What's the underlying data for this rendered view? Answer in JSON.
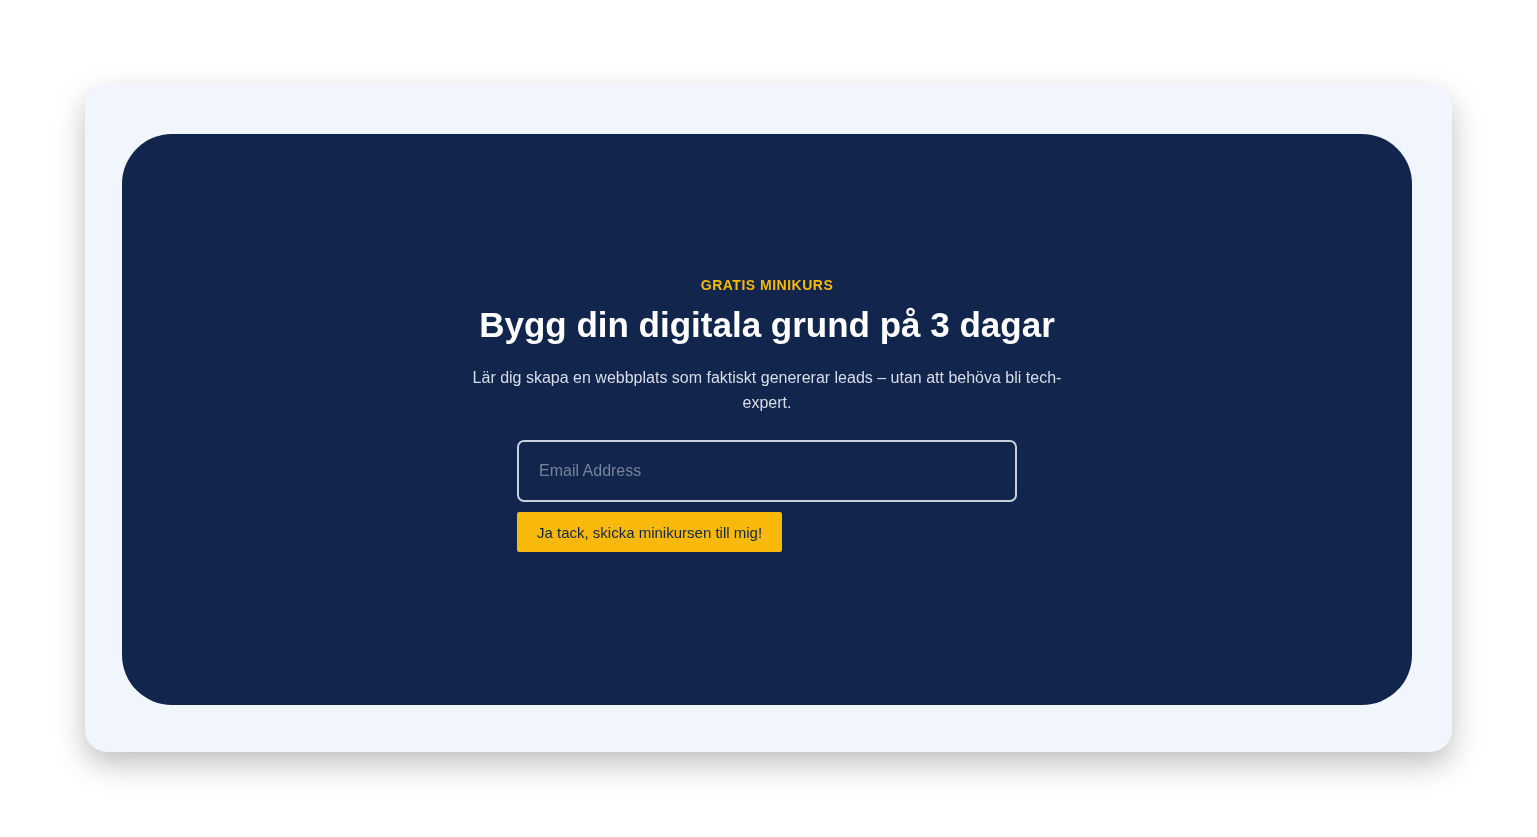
{
  "eyebrow": "GRATIS MINIKURS",
  "heading": "Bygg din digitala grund på 3 dagar",
  "description": "Lär dig skapa en webbplats som faktiskt genererar leads – utan att behöva bli tech-expert.",
  "email_field": {
    "placeholder": "Email Address"
  },
  "submit_button": "Ja tack, skicka minikursen till mig!"
}
